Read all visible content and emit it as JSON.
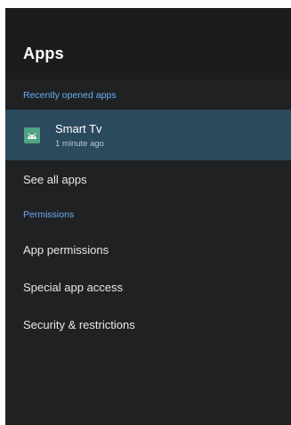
{
  "header": {
    "title": "Apps"
  },
  "recent_section": {
    "label": "Recently opened apps",
    "items": [
      {
        "name": "Smart Tv",
        "time": "1 minute ago",
        "icon": "android-icon",
        "icon_color": "#4fa386"
      }
    ]
  },
  "see_all_label": "See all apps",
  "permissions_section": {
    "label": "Permissions",
    "items": [
      {
        "label": "App permissions"
      },
      {
        "label": "Special app access"
      },
      {
        "label": "Security & restrictions"
      }
    ]
  },
  "colors": {
    "background": "#1f2123",
    "header_background": "#1a1c1e",
    "accent": "#6ab0f3",
    "selected": "#2c4a5e"
  }
}
